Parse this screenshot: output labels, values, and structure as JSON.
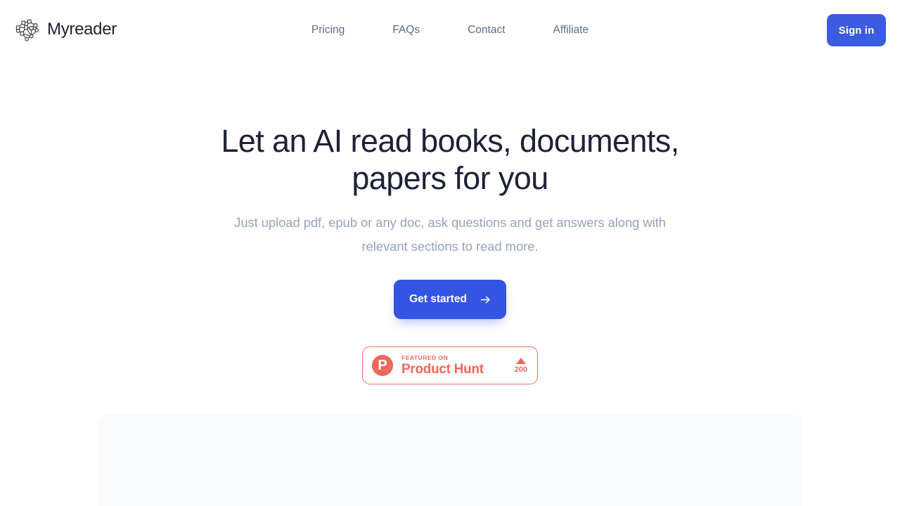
{
  "header": {
    "brand": {
      "name": "Myreader",
      "logo_icon": "network-graph-icon"
    },
    "nav": [
      {
        "label": "Pricing"
      },
      {
        "label": "FAQs"
      },
      {
        "label": "Contact"
      },
      {
        "label": "Affiliate"
      }
    ],
    "signin_label": "Sign in"
  },
  "hero": {
    "title": "Let an AI read books, documents, papers for you",
    "subtitle": "Just upload pdf, epub or any doc, ask questions and get answers along with relevant sections to read more.",
    "cta_label": "Get started",
    "cta_arrow_icon": "arrow-right-icon"
  },
  "product_hunt": {
    "logo_letter": "P",
    "featured_label": "FEATURED ON",
    "name": "Product Hunt",
    "upvote_icon": "triangle-up-icon",
    "upvote_count": "200"
  },
  "colors": {
    "brand_blue": "#3455e4",
    "signin_blue": "#3b5be0",
    "headline": "#1e2235",
    "subtitle": "#97a3bd",
    "nav_link": "#5c6b8a",
    "product_hunt": "#f0685a",
    "panel_bg": "#f8fafc",
    "page_bg": "#ffffff"
  }
}
